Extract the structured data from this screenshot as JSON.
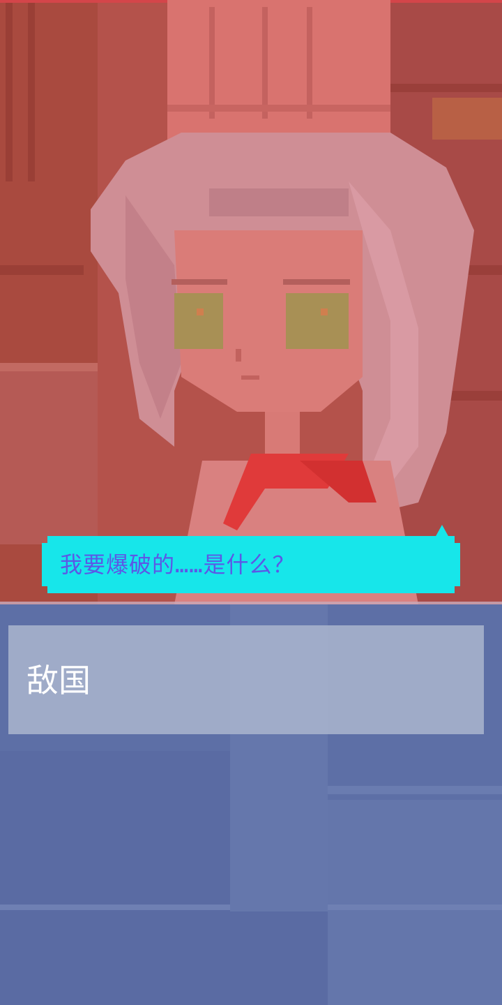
{
  "scene": {
    "character": "cook-girl",
    "tint_top": "#b8564f",
    "tint_bottom": "#5d6fa6"
  },
  "dialogue": {
    "question": "我要爆破的……是什么？",
    "bubble_color": "#17e6ea",
    "text_color": "#5b58e6"
  },
  "choices": [
    {
      "label": "敌国"
    }
  ]
}
